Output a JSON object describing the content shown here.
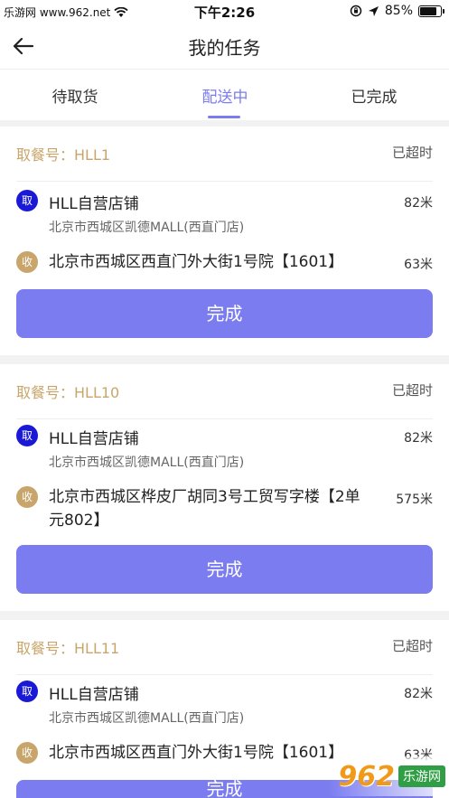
{
  "status_bar": {
    "carrier": "乐游网 www.962.net",
    "time": "下午2:26",
    "battery_text": "85%",
    "battery_level": 0.85
  },
  "nav": {
    "title": "我的任务"
  },
  "tabs": [
    {
      "label": "待取货",
      "active": false
    },
    {
      "label": "配送中",
      "active": true
    },
    {
      "label": "已完成",
      "active": false
    }
  ],
  "orders": [
    {
      "order_no": "取餐号：HLL1",
      "status": "已超时",
      "pick_badge": "取",
      "shop_name": "HLL自营店铺",
      "shop_address": "北京市西城区凯德MALL(西直门店)",
      "shop_distance": "82米",
      "recv_badge": "收",
      "dest_address": "北京市西城区西直门外大街1号院【1601】",
      "dest_distance": "63米",
      "button": "完成"
    },
    {
      "order_no": "取餐号：HLL10",
      "status": "已超时",
      "pick_badge": "取",
      "shop_name": "HLL自营店铺",
      "shop_address": "北京市西城区凯德MALL(西直门店)",
      "shop_distance": "82米",
      "recv_badge": "收",
      "dest_address": "北京市西城区桦皮厂胡同3号工贸写字楼【2单元802】",
      "dest_distance": "575米",
      "button": "完成"
    },
    {
      "order_no": "取餐号：HLL11",
      "status": "已超时",
      "pick_badge": "取",
      "shop_name": "HLL自营店铺",
      "shop_address": "北京市西城区凯德MALL(西直门店)",
      "shop_distance": "82米",
      "recv_badge": "收",
      "dest_address": "北京市西城区西直门外大街1号院【1601】",
      "dest_distance": "63米",
      "button": "完成"
    }
  ],
  "watermark": {
    "number": "962",
    "text": "乐游网"
  },
  "colors": {
    "accent": "#7b7cf0",
    "gold": "#c8a66b",
    "pick": "#1a1ad6"
  }
}
